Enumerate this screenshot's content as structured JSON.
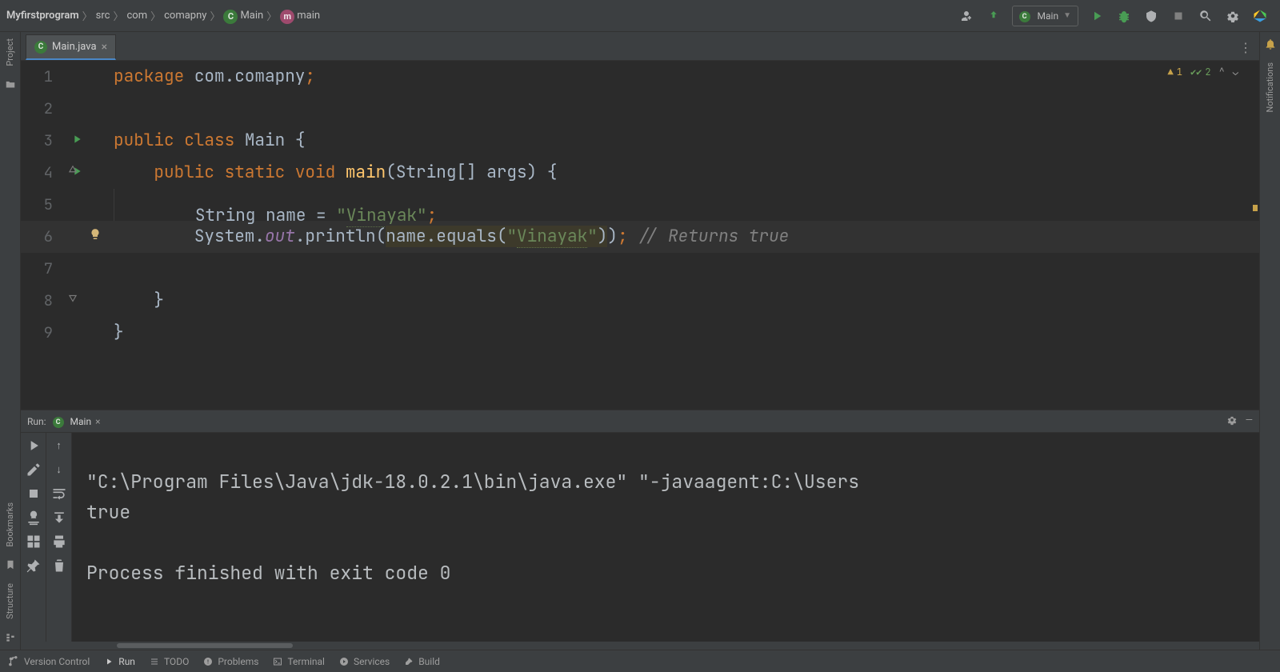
{
  "breadcrumbs": {
    "project": "Myfirstprogram",
    "b1": "src",
    "b2": "com",
    "b3": "comapny",
    "b4": "Main",
    "b5": "main"
  },
  "toolbar": {
    "run_config": "Main"
  },
  "tab": {
    "filename": "Main.java",
    "file_letter": "C"
  },
  "inspections": {
    "warn_count": "1",
    "ok_count": "2"
  },
  "code": {
    "l1": {
      "num": "1",
      "kw": "package ",
      "rest": "com.comapny",
      "semi": ";"
    },
    "l2": {
      "num": "2"
    },
    "l3": {
      "num": "3",
      "kw": "public class ",
      "name": "Main ",
      "brace": "{"
    },
    "l4": {
      "num": "4",
      "kw": "public static void ",
      "name": "main",
      "args": "(String[] args) {",
      "indent": "    "
    },
    "l5": {
      "num": "5",
      "indent": "        ",
      "type": "String ",
      "var": "name = ",
      "str": "\"",
      "strv": "Vinayak",
      "str2": "\"",
      "semi": ";"
    },
    "l6": {
      "num": "6",
      "indent": "        ",
      "call": "System.",
      "out": "out",
      "rest": ".println(",
      "arg": "name.equals(",
      "str": "\"",
      "strv": "Vinayak",
      "str2": "\"",
      "close": "));",
      "comm": " // Returns true"
    },
    "l7": {
      "num": "7"
    },
    "l8": {
      "num": "8",
      "indent": "    ",
      "brace": "}"
    },
    "l9": {
      "num": "9",
      "brace": "}"
    }
  },
  "run": {
    "title": "Run:",
    "tab_name": "Main",
    "console_l1": "\"C:\\Program Files\\Java\\jdk-18.0.2.1\\bin\\java.exe\" \"-javaagent:C:\\Users",
    "console_l2": "true",
    "console_l3": "",
    "console_l4": "Process finished with exit code 0"
  },
  "left_rail": {
    "project": "Project",
    "bookmarks": "Bookmarks",
    "structure": "Structure"
  },
  "right_rail": {
    "notifications": "Notifications"
  },
  "status": {
    "vc": "Version Control",
    "run": "Run",
    "todo": "TODO",
    "problems": "Problems",
    "terminal": "Terminal",
    "services": "Services",
    "build": "Build"
  }
}
